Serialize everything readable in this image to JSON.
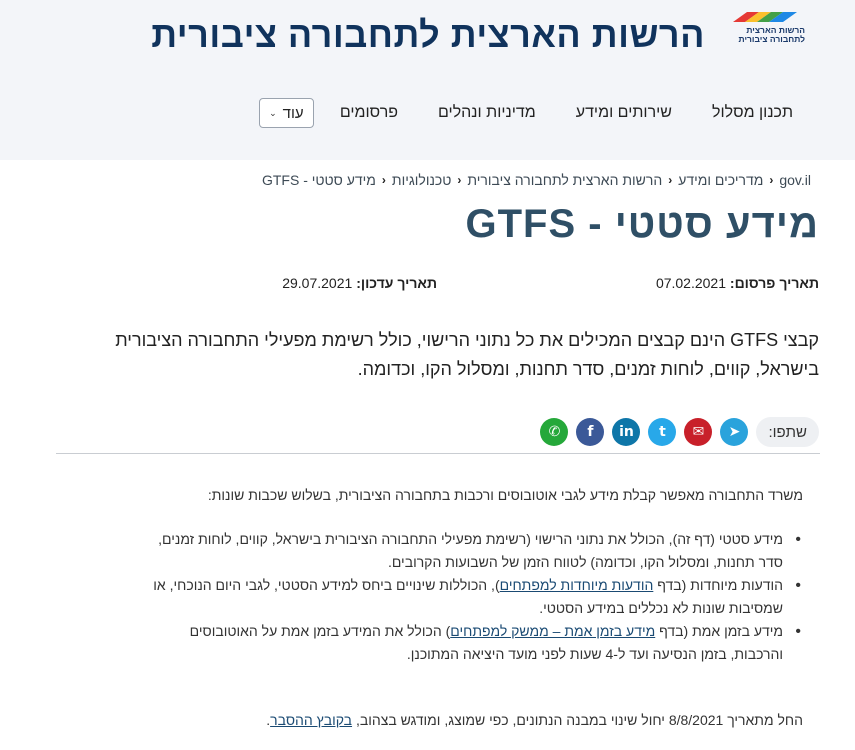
{
  "header": {
    "site_title": "הרשות הארצית לתחבורה ציבורית",
    "logo_text_line1": "הרשות הארצית",
    "logo_text_line2": "לתחבורה ציבורית",
    "nav": [
      {
        "label": "תכנון מסלול"
      },
      {
        "label": "שירותים ומידע"
      },
      {
        "label": "מדיניות ונהלים"
      },
      {
        "label": "פרסומים"
      }
    ],
    "more_label": "עוד"
  },
  "breadcrumb": [
    {
      "label": "gov.il"
    },
    {
      "label": "מדריכים ומידע"
    },
    {
      "label": "הרשות הארצית לתחבורה ציבורית"
    },
    {
      "label": "טכנולוגיות"
    },
    {
      "label": "מידע סטטי - GTFS"
    }
  ],
  "page": {
    "title": "מידע סטטי - GTFS",
    "published_label": "תאריך פרסום:",
    "published_value": "07.02.2021",
    "updated_label": "תאריך עדכון:",
    "updated_value": "29.07.2021",
    "lead_line1": "קבצי GTFS הינם קבצים המכילים את כל נתוני הרישוי, כולל רשימת מפעילי התחבורה הציבורית",
    "lead_line2": "בישראל, קווים, לוחות זמנים, סדר תחנות, ומסלול הקו, וכדומה."
  },
  "share": {
    "label": "שתפו:",
    "buttons": [
      {
        "icon": "telegram-icon",
        "glyph": "➤",
        "color": "#2aa3dc"
      },
      {
        "icon": "email-icon",
        "glyph": "✉",
        "color": "#c8202a"
      },
      {
        "icon": "twitter-icon",
        "glyph": "t",
        "color": "#28a8e9"
      },
      {
        "icon": "linkedin-icon",
        "glyph": "in",
        "color": "#0e76a8"
      },
      {
        "icon": "facebook-icon",
        "glyph": "f",
        "color": "#3b5998"
      },
      {
        "icon": "whatsapp-icon",
        "glyph": "✆",
        "color": "#25a83a"
      }
    ]
  },
  "content": {
    "intro": "משרד התחבורה מאפשר קבלת מידע לגבי אוטובוסים ורכבות בתחבורה הציבורית, בשלוש שכבות שונות:",
    "bullet1_line1": "מידע סטטי (דף זה), הכולל את נתוני הרישוי (רשימת מפעילי התחבורה הציבורית בישראל, קווים, לוחות זמנים,",
    "bullet1_line2": "סדר תחנות, ומסלול הקו, וכדומה) לטווח הזמן של השבועות הקרובים.",
    "bullet2_pre": "הודעות מיוחדות (בדף ",
    "bullet2_link": "הודעות מיוחדות למפתחים",
    "bullet2_post": "), הכוללות שינויים ביחס למידע הסטטי, לגבי היום הנוכחי, או",
    "bullet2_line2": "שמסיבות שונות לא נכללים במידע הסטטי.",
    "bullet3_pre": "מידע בזמן אמת (בדף ",
    "bullet3_link": "מידע בזמן אמת – ממשק למפתחים",
    "bullet3_post": ") הכולל את המידע בזמן אמת על האוטובוסים",
    "bullet3_line2": "והרכבות, בזמן הנסיעה ועד ל-4 שעות לפני מועד היציאה המתוכנן.",
    "footer_pre": "החל מתאריך 8/8/2021 יחול שינוי במבנה הנתונים, כפי שמוצג, ומודגש בצהוב, ",
    "footer_link": "בקובץ ההסבר",
    "footer_post": "."
  }
}
